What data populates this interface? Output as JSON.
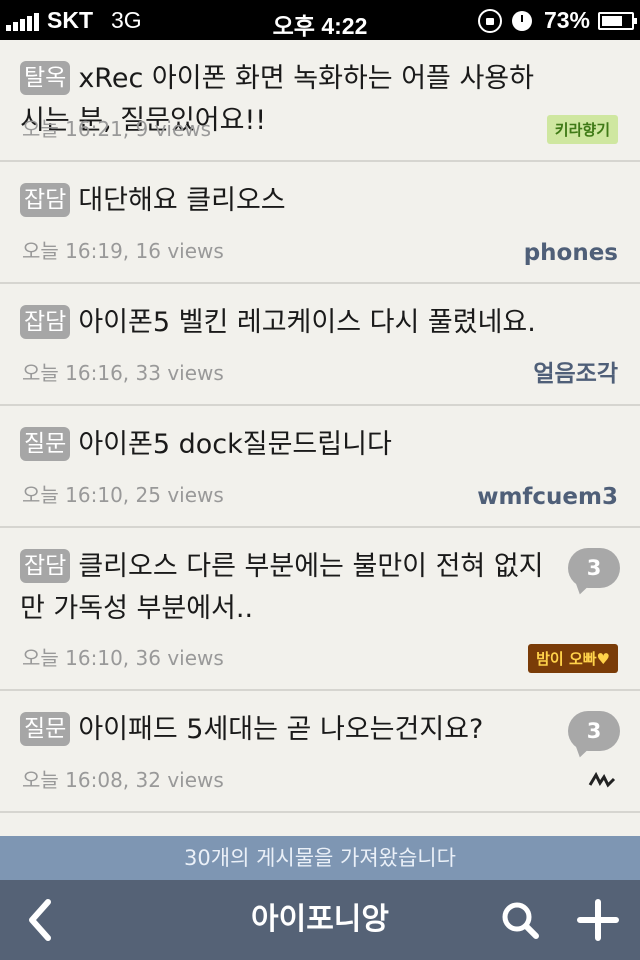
{
  "status_bar": {
    "carrier": "SKT",
    "network": "3G",
    "time": "오후 4:22",
    "battery_percent": "73%",
    "battery_level": 0.73,
    "signal_bars": 5
  },
  "posts": [
    {
      "tag": "탈옥",
      "title": "xRec 아이폰 화면 녹화하는 어플 사용하시는 분, 질문있어요!!",
      "meta": "오늘 16:21, 9 views",
      "author": "키라향기",
      "author_style": "image-badge-green",
      "comments": ""
    },
    {
      "tag": "잡담",
      "title": "대단해요 클리오스",
      "meta": "오늘 16:19, 16 views",
      "author": "phones",
      "author_style": "text",
      "comments": ""
    },
    {
      "tag": "잡담",
      "title": "아이폰5 벨킨 레고케이스 다시 풀렸네요.",
      "meta": "오늘 16:16, 33 views",
      "author": "얼음조각",
      "author_style": "text",
      "comments": ""
    },
    {
      "tag": "질문",
      "title": "아이폰5 dock질문드립니다",
      "meta": "오늘 16:10, 25 views",
      "author": "wmfcuem3",
      "author_style": "text",
      "comments": ""
    },
    {
      "tag": "잡담",
      "title": "클리오스 다른 부분에는 불만이 전혀 없지만 가독성 부분에서..",
      "meta": "오늘 16:10, 36 views",
      "author": "밤이 오빠♥",
      "author_style": "image-badge-orange",
      "comments": "3"
    },
    {
      "tag": "질문",
      "title": "아이패드 5세대는 곧 나오는건지요?",
      "meta": "오늘 16:08, 32 views",
      "author": "",
      "author_style": "image-squiggle",
      "comments": "3"
    }
  ],
  "banner": {
    "text": "30개의 게시물을 가져왔습니다"
  },
  "navbar": {
    "title": "아이포니앙",
    "icons": [
      "back-chevron-icon",
      "search-icon",
      "plus-icon"
    ]
  },
  "colors": {
    "background": "#f2f1ec",
    "tag": "#a6a6a6",
    "author": "#4f5f78",
    "banner": "#7e96b3",
    "navbar": "#556276"
  }
}
